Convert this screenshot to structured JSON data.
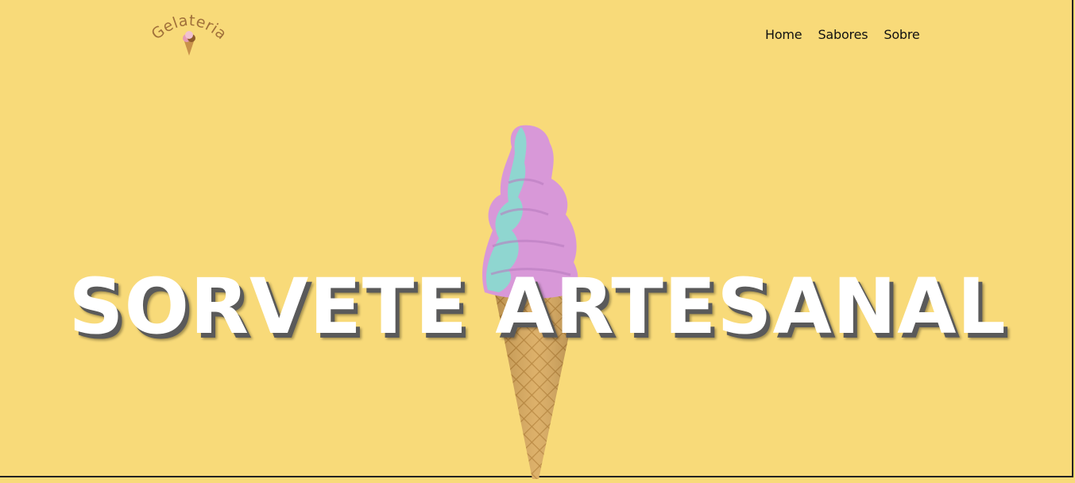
{
  "brand": {
    "name": "Gelateria",
    "color": "#a0703a"
  },
  "nav": {
    "items": [
      {
        "label": "Home"
      },
      {
        "label": "Sabores"
      },
      {
        "label": "Sobre"
      }
    ]
  },
  "hero": {
    "title": "SORVETE ARTESANAL",
    "image": "ice-cream-cone",
    "background": "#f8da79"
  }
}
